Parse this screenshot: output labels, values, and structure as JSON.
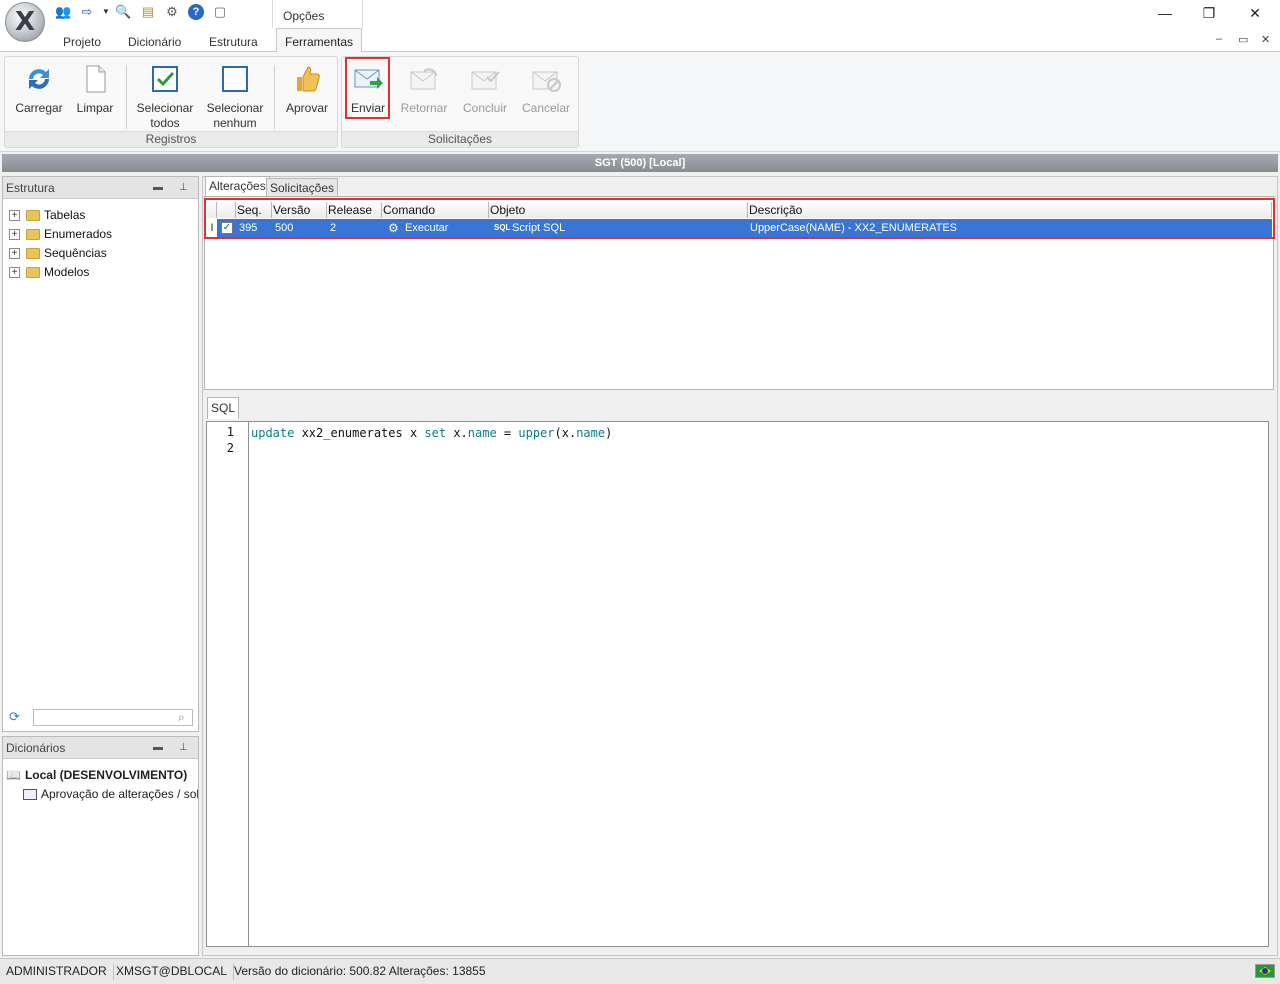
{
  "window": {
    "quick_access_icons": [
      "users-icon",
      "export-icon",
      "dropdown-arrow-icon",
      "search-icon",
      "documents-icon",
      "gear-icon",
      "help-icon",
      "page-icon"
    ],
    "options_label": "Opções",
    "controls": {
      "minimize": "—",
      "restore": "❐",
      "close": "✕"
    }
  },
  "ribbon": {
    "tabs": [
      {
        "label": "Projeto"
      },
      {
        "label": "Dicionário"
      },
      {
        "label": "Estrutura"
      },
      {
        "label": "Ferramentas",
        "active": true
      }
    ],
    "registros": {
      "label": "Registros",
      "buttons": {
        "carregar": "Carregar",
        "limpar": "Limpar",
        "selecionar_todos": "Selecionar todos",
        "selecionar_nenhum": "Selecionar nenhum",
        "aprovar": "Aprovar"
      }
    },
    "solicitacoes": {
      "label": "Solicitações",
      "buttons": {
        "enviar": "Enviar",
        "retornar": "Retornar",
        "concluir": "Concluir",
        "cancelar": "Cancelar"
      }
    }
  },
  "document_title": "SGT (500) [Local]",
  "estrutura": {
    "title": "Estrutura",
    "items": [
      "Tabelas",
      "Enumerados",
      "Sequências",
      "Modelos"
    ],
    "search_placeholder": ""
  },
  "dicionarios": {
    "title": "Dicionários",
    "root": "Local (DESENVOLVIMENTO)",
    "child": "Aprovação de alterações / solici"
  },
  "content_tabs": {
    "alteracoes": "Alterações",
    "solicitacoes": "Solicitações"
  },
  "grid": {
    "columns": [
      "Seq.",
      "Versão",
      "Release",
      "Comando",
      "Objeto",
      "Descrição"
    ],
    "rows": [
      {
        "indicator": "I",
        "checked": true,
        "seq": "395",
        "versao": "500",
        "release": "2",
        "comando": "Executar",
        "objeto": "Script SQL",
        "descricao": "UpperCase(NAME) - XX2_ENUMERATES"
      }
    ]
  },
  "sql_tab": "SQL",
  "editor": {
    "line_numbers": [
      "1",
      "2"
    ],
    "code_tokens": [
      {
        "text": "update",
        "kw": true
      },
      {
        "text": " xx2_enumerates x ",
        "kw": false
      },
      {
        "text": "set",
        "kw": true
      },
      {
        "text": " x.",
        "kw": false
      },
      {
        "text": "name",
        "kw": true
      },
      {
        "text": " = ",
        "kw": false
      },
      {
        "text": "upper",
        "kw": true
      },
      {
        "text": "(x.",
        "kw": false
      },
      {
        "text": "name",
        "kw": true
      },
      {
        "text": ")",
        "kw": false
      }
    ]
  },
  "statusbar": {
    "user": "ADMINISTRADOR",
    "connection": "XMSGT@DBLOCAL",
    "version_info": "Versão do dicionário: 500.82 Alterações: 13855"
  },
  "colors": {
    "selection": "#3875d7",
    "highlight_border": "#e03030",
    "keyword": "#0b7d8a"
  }
}
